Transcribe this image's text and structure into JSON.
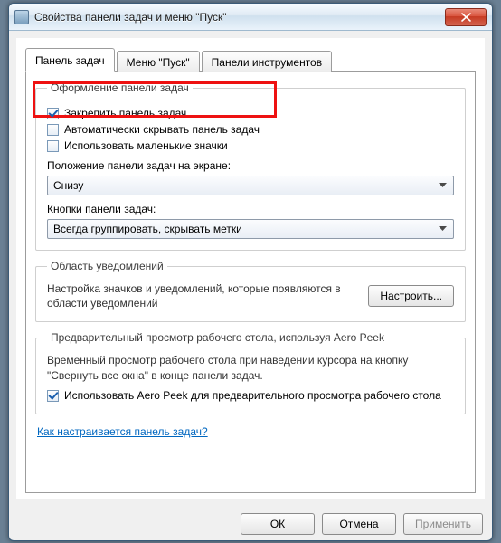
{
  "window": {
    "title": "Свойства панели задач и меню \"Пуск\""
  },
  "tabs": [
    {
      "label": "Панель задач",
      "active": true
    },
    {
      "label": "Меню \"Пуск\"",
      "active": false
    },
    {
      "label": "Панели инструментов",
      "active": false
    }
  ],
  "group_appearance": {
    "legend": "Оформление панели задач",
    "lock": {
      "label": "Закрепить панель задач",
      "checked": true
    },
    "autohide": {
      "label": "Автоматически скрывать панель задач",
      "checked": false
    },
    "small_icons": {
      "label": "Использовать маленькие значки",
      "checked": false
    },
    "position_label": "Положение панели задач на экране:",
    "position_value": "Снизу",
    "buttons_label": "Кнопки панели задач:",
    "buttons_value": "Всегда группировать, скрывать метки"
  },
  "group_notify": {
    "legend": "Область уведомлений",
    "note": "Настройка значков и уведомлений, которые появляются в области уведомлений",
    "customize_label": "Настроить..."
  },
  "group_aeropeek": {
    "legend": "Предварительный просмотр рабочего стола, используя Aero Peek",
    "note": "Временный просмотр рабочего стола при наведении курсора на кнопку \"Свернуть все окна\" в конце панели задач.",
    "peek": {
      "label": "Использовать Aero Peek для предварительного просмотра рабочего стола",
      "checked": true
    }
  },
  "help_link": "Как настраивается панель задач?",
  "buttons": {
    "ok": "ОК",
    "cancel": "Отмена",
    "apply": "Применить"
  }
}
